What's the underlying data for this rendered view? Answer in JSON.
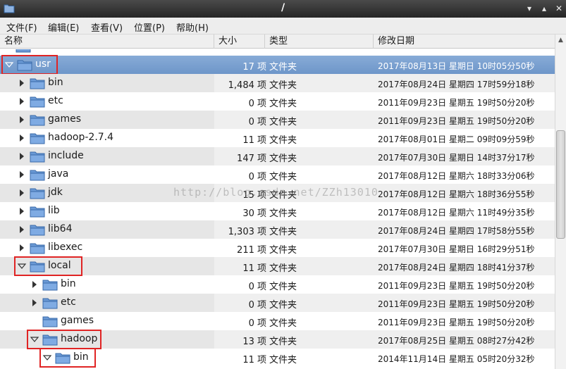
{
  "window": {
    "title": "/",
    "controls": [
      "▾",
      "▴",
      "✕"
    ]
  },
  "menu": [
    {
      "label": "文件(F)"
    },
    {
      "label": "编辑(E)"
    },
    {
      "label": "查看(V)"
    },
    {
      "label": "位置(P)"
    },
    {
      "label": "帮助(H)"
    }
  ],
  "columns": {
    "name": "名称",
    "size": "大小",
    "type": "类型",
    "date": "修改日期"
  },
  "rows": [
    {
      "name": "usr",
      "size": "17 项",
      "type": "文件夹",
      "date": "2017年08月13日 星期日 10时05分50秒",
      "level": 0,
      "expanded": true,
      "selected": true,
      "highlight": true
    },
    {
      "name": "bin",
      "size": "1,484 项",
      "type": "文件夹",
      "date": "2017年08月24日 星期四 17时59分18秒",
      "level": 1,
      "expanded": false
    },
    {
      "name": "etc",
      "size": "0 项",
      "type": "文件夹",
      "date": "2011年09月23日 星期五 19时50分20秒",
      "level": 1,
      "expanded": false
    },
    {
      "name": "games",
      "size": "0 项",
      "type": "文件夹",
      "date": "2011年09月23日 星期五 19时50分20秒",
      "level": 1,
      "expanded": false
    },
    {
      "name": "hadoop-2.7.4",
      "size": "11 项",
      "type": "文件夹",
      "date": "2017年08月01日 星期二 09时09分59秒",
      "level": 1,
      "expanded": false
    },
    {
      "name": "include",
      "size": "147 项",
      "type": "文件夹",
      "date": "2017年07月30日 星期日 14时37分17秒",
      "level": 1,
      "expanded": false
    },
    {
      "name": "java",
      "size": "0 项",
      "type": "文件夹",
      "date": "2017年08月12日 星期六 18时33分06秒",
      "level": 1,
      "expanded": false
    },
    {
      "name": "jdk",
      "size": "15 项",
      "type": "文件夹",
      "date": "2017年08月12日 星期六 18时36分55秒",
      "level": 1,
      "expanded": false
    },
    {
      "name": "lib",
      "size": "30 项",
      "type": "文件夹",
      "date": "2017年08月12日 星期六 11时49分35秒",
      "level": 1,
      "expanded": false
    },
    {
      "name": "lib64",
      "size": "1,303 项",
      "type": "文件夹",
      "date": "2017年08月24日 星期四 17时58分55秒",
      "level": 1,
      "expanded": false
    },
    {
      "name": "libexec",
      "size": "211 项",
      "type": "文件夹",
      "date": "2017年07月30日 星期日 16时29分51秒",
      "level": 1,
      "expanded": false
    },
    {
      "name": "local",
      "size": "11 项",
      "type": "文件夹",
      "date": "2017年08月24日 星期四 18时41分37秒",
      "level": 1,
      "expanded": true,
      "highlight": true
    },
    {
      "name": "bin",
      "size": "0 项",
      "type": "文件夹",
      "date": "2011年09月23日 星期五 19时50分20秒",
      "level": 2,
      "expanded": false
    },
    {
      "name": "etc",
      "size": "0 项",
      "type": "文件夹",
      "date": "2011年09月23日 星期五 19时50分20秒",
      "level": 2,
      "expanded": false
    },
    {
      "name": "games",
      "size": "0 项",
      "type": "文件夹",
      "date": "2011年09月23日 星期五 19时50分20秒",
      "level": 2,
      "expanded": false,
      "noExpander": true
    },
    {
      "name": "hadoop",
      "size": "13 项",
      "type": "文件夹",
      "date": "2017年08月25日 星期五 08时27分42秒",
      "level": 2,
      "expanded": true,
      "highlight": true
    },
    {
      "name": "bin",
      "size": "11 项",
      "type": "文件夹",
      "date": "2014年11月14日 星期五 05时20分32秒",
      "level": 3,
      "expanded": true,
      "highlight": true
    }
  ],
  "watermark": "http://blog.csdn.net/ZZh13010",
  "colors": {
    "selection": "#7aa0d0",
    "highlight": "#e02424",
    "folder": "#5a8fd0"
  }
}
